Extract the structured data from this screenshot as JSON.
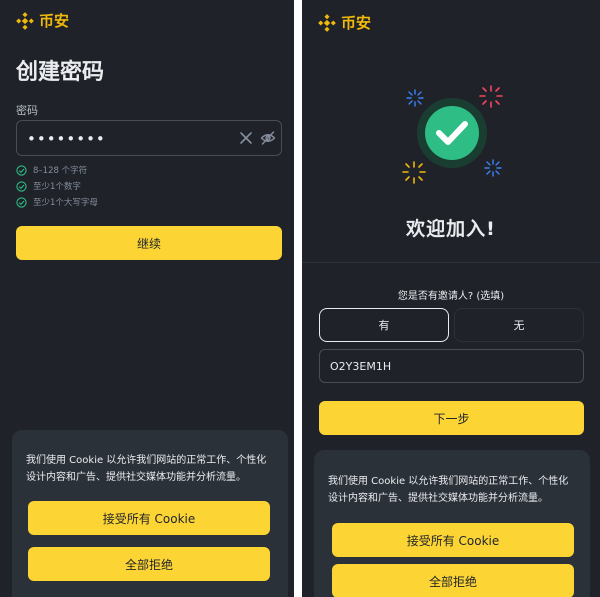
{
  "brand": {
    "name": "币安",
    "color": "#F0B90B"
  },
  "left": {
    "title": "创建密码",
    "password_label": "密码",
    "password_value": "••••••••",
    "icons": [
      "clear-icon",
      "eye-off-icon"
    ],
    "requirements": [
      "8–128 个字符",
      "至少1个数字",
      "至少1个大写字母"
    ],
    "continue_label": "继续"
  },
  "right": {
    "welcome_title": "欢迎加入!",
    "referral_question": "您是否有邀请人? (选填)",
    "yes_label": "有",
    "no_label": "无",
    "referral_code": "O2Y3EM1H",
    "next_label": "下一步"
  },
  "cookie": {
    "text_line1": "我们使用 Cookie 以允许我们网站的正常工作、个性化",
    "text_line2": "设计内容和广告、提供社交媒体功能并分析流量。",
    "accept_all_label": "接受所有 Cookie",
    "reject_all_label": "全部拒绝"
  },
  "colors": {
    "background": "#1F2229",
    "card": "#2B3139",
    "accent": "#FCD535",
    "success": "#2EBD85"
  }
}
